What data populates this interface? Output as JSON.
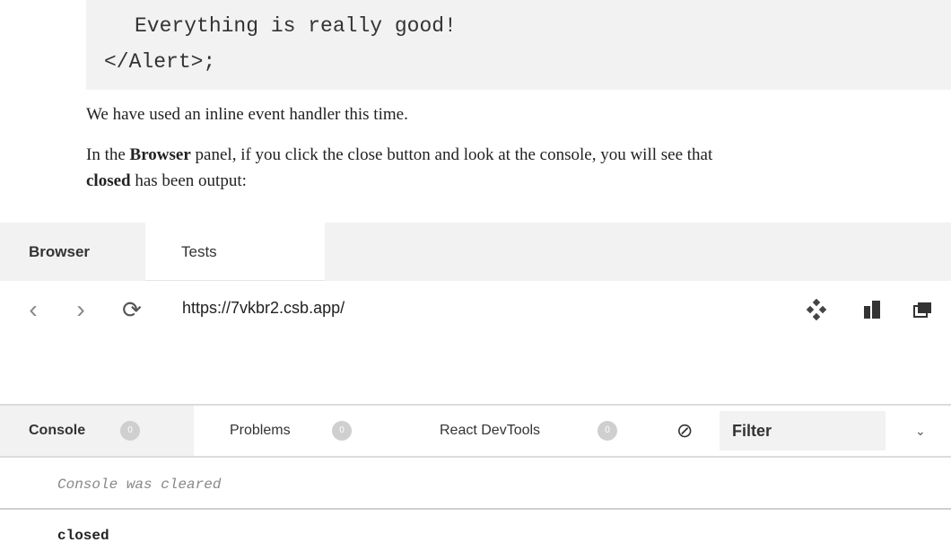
{
  "code": {
    "line1": "Everything is really good!",
    "line2": "</Alert>;"
  },
  "paragraphs": {
    "p1": "We have used an inline event handler this time.",
    "p2_before": "In the ",
    "p2_bold1": "Browser",
    "p2_after": " panel, if you click the close button and look at the console, you will see that",
    "p3_bold": "closed",
    "p3_after": " has been output:"
  },
  "browser": {
    "tabs": [
      {
        "label": "Browser",
        "active": true
      },
      {
        "label": "Tests",
        "active": false
      }
    ],
    "back_glyph": "‹",
    "forward_glyph": "›",
    "refresh_glyph": "⟳",
    "url": "https://7vkbr2.csb.app/",
    "icons": [
      "codesandbox-icon",
      "split-view-icon",
      "new-window-icon"
    ]
  },
  "console": {
    "tabs": [
      {
        "label": "Console",
        "badge": "0"
      },
      {
        "label": "Problems",
        "badge": "0"
      },
      {
        "label": "React DevTools",
        "badge": "0"
      }
    ],
    "clear_icon": "⊘",
    "filter_label": "Filter",
    "chevron": "⌄",
    "messages": [
      "Console was cleared",
      "closed"
    ]
  },
  "colors": {
    "panel_bg": "#f2f2f2",
    "badge": "#cfcfcf",
    "muted": "#888888"
  }
}
